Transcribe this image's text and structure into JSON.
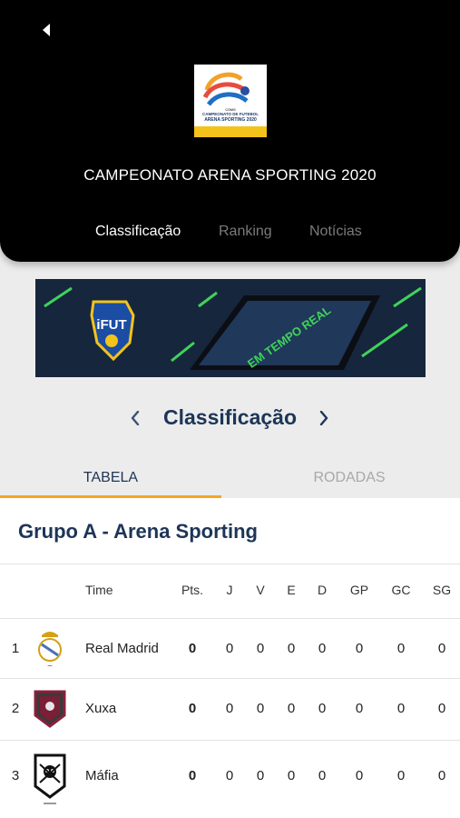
{
  "header": {
    "title": "CAMPEONATO ARENA SPORTING 2020",
    "logo_text": [
      "CAMPEONATO DE FUTEBOL",
      "ARENA SPORTING 2020",
      "CSMS"
    ],
    "tabs": [
      {
        "label": "Classificação",
        "active": true
      },
      {
        "label": "Ranking",
        "active": false
      },
      {
        "label": "Notícias",
        "active": false
      }
    ]
  },
  "banner": {
    "brand": "iFUT",
    "phone_text": "EM TEMPO REAL"
  },
  "section": {
    "title": "Classificação"
  },
  "subtabs": [
    {
      "label": "TABELA",
      "active": true
    },
    {
      "label": "RODADAS",
      "active": false
    }
  ],
  "group": {
    "title": "Grupo A - Arena Sporting"
  },
  "table": {
    "headers": {
      "team": "Time",
      "pts": "Pts.",
      "j": "J",
      "v": "V",
      "e": "E",
      "d": "D",
      "gp": "GP",
      "gc": "GC",
      "sg": "SG"
    },
    "rows": [
      {
        "pos": "1",
        "team": "Real Madrid",
        "pts": "0",
        "j": "0",
        "v": "0",
        "e": "0",
        "d": "0",
        "gp": "0",
        "gc": "0",
        "sg": "0"
      },
      {
        "pos": "2",
        "team": "Xuxa",
        "pts": "0",
        "j": "0",
        "v": "0",
        "e": "0",
        "d": "0",
        "gp": "0",
        "gc": "0",
        "sg": "0"
      },
      {
        "pos": "3",
        "team": "Máfia",
        "pts": "0",
        "j": "0",
        "v": "0",
        "e": "0",
        "d": "0",
        "gp": "0",
        "gc": "0",
        "sg": "0"
      }
    ]
  },
  "colors": {
    "header_bg": "#000000",
    "accent": "#f5a623",
    "title_navy": "#1d3557",
    "inactive_tab": "#7a7a7a"
  }
}
